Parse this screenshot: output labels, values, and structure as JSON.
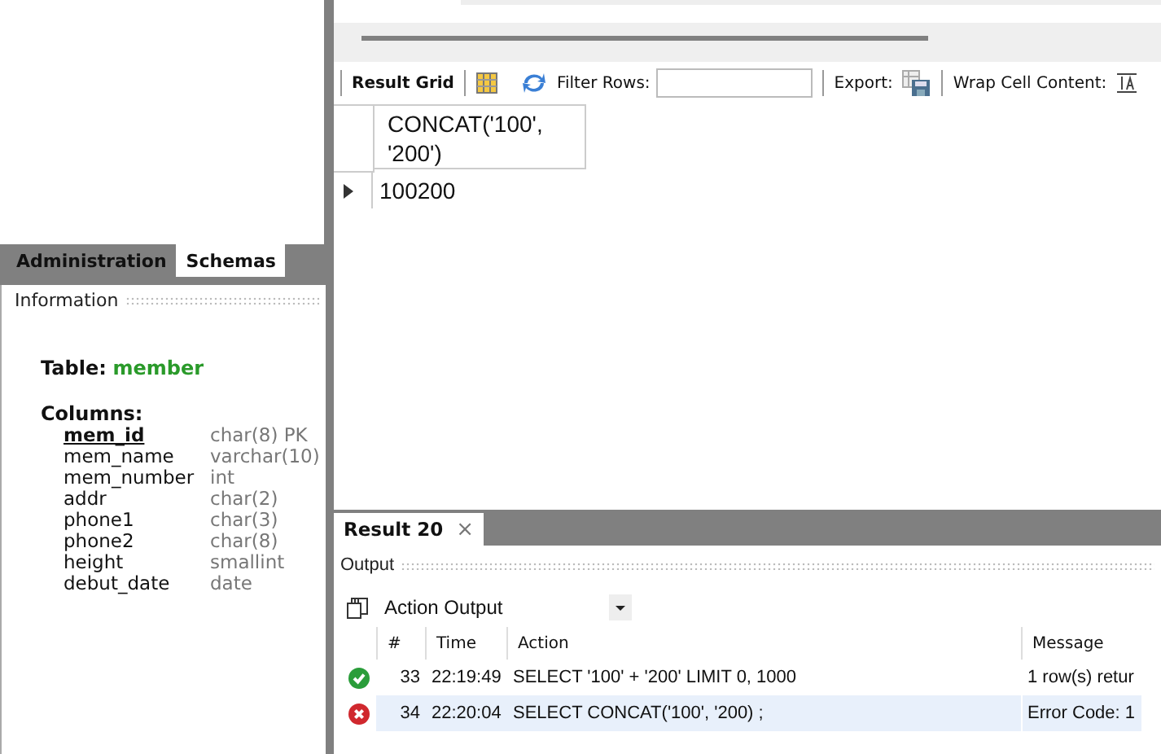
{
  "sidebar": {
    "tabs": [
      {
        "label": "Administration",
        "selected": false
      },
      {
        "label": "Schemas",
        "selected": true
      }
    ],
    "information": {
      "title": "Information",
      "table_label": "Table:",
      "table_name": "member",
      "columns_label": "Columns:",
      "columns": [
        {
          "name": "mem_id",
          "type": "char(8) PK",
          "primary": true
        },
        {
          "name": "mem_name",
          "type": "varchar(10)",
          "primary": false
        },
        {
          "name": "mem_number",
          "type": "int",
          "primary": false
        },
        {
          "name": "addr",
          "type": "char(2)",
          "primary": false
        },
        {
          "name": "phone1",
          "type": "char(3)",
          "primary": false
        },
        {
          "name": "phone2",
          "type": "char(8)",
          "primary": false
        },
        {
          "name": "height",
          "type": "smallint",
          "primary": false
        },
        {
          "name": "debut_date",
          "type": "date",
          "primary": false
        }
      ]
    }
  },
  "toolbar": {
    "result_grid": "Result Grid",
    "filter_label": "Filter Rows:",
    "export_label": "Export:",
    "wrap_label": "Wrap Cell Content:"
  },
  "grid": {
    "columns": [
      "CONCAT('100', '200')"
    ],
    "rows": [
      [
        "100200"
      ]
    ]
  },
  "result_tabs": [
    {
      "label": "Result 20",
      "close": "×",
      "selected": true
    }
  ],
  "output": {
    "title": "Output",
    "selector": "Action Output",
    "columns": [
      "#",
      "Time",
      "Action",
      "Message"
    ],
    "rows": [
      {
        "kind": "ok",
        "selected": false,
        "num": "33",
        "time": "22:19:49",
        "action": "SELECT '100' + '200' LIMIT 0, 1000",
        "message": "1 row(s) retur"
      },
      {
        "kind": "error",
        "selected": true,
        "num": "34",
        "time": "22:20:04",
        "action": "SELECT CONCAT('100', '200) ;",
        "message": "Error Code: 1"
      }
    ]
  }
}
